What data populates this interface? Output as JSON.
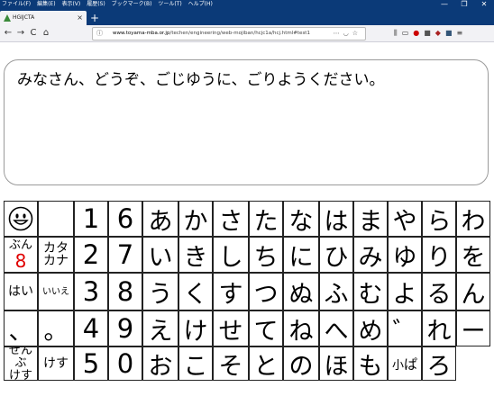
{
  "browser": {
    "menu_items": [
      "ファイル(F)",
      "編集(E)",
      "表示(V)",
      "履歴(S)",
      "ブックマーク(B)",
      "ツール(T)",
      "ヘルプ(H)"
    ],
    "window_controls": [
      "—",
      "❐",
      "✕"
    ],
    "tab_title": "HGIJCTA",
    "tab_close": "×",
    "new_tab": "+",
    "url_domain": "www.toyama-mba.or.jp",
    "url_path": "/techen/engineering/web-mojiban/hcjc1a/hcj.html#test1",
    "nav": {
      "back": "←",
      "forward": "→",
      "reload": "C",
      "home": "⌂"
    }
  },
  "message": {
    "text": "みなさん、どうぞ、ごじゆうに、ごりようください。"
  },
  "keyboard": {
    "rows": [
      [
        "smiley",
        "",
        "1",
        "6",
        "あ",
        "か",
        "さ",
        "た",
        "な",
        "は",
        "ま",
        "や",
        "ら",
        "わ"
      ],
      [
        "ぶん8",
        "カタカナ",
        "2",
        "7",
        "い",
        "き",
        "し",
        "ち",
        "に",
        "ひ",
        "み",
        "ゆ",
        "り",
        "を"
      ],
      [
        "はい",
        "いいえ",
        "3",
        "8",
        "う",
        "く",
        "す",
        "つ",
        "ぬ",
        "ふ",
        "む",
        "よ",
        "る",
        "ん"
      ],
      [
        "、",
        "。",
        "4",
        "9",
        "え",
        "け",
        "せ",
        "て",
        "ね",
        "へ",
        "め",
        "゛",
        "れ",
        "ー"
      ],
      [
        "ぜんぶけす",
        "けす",
        "5",
        "0",
        "お",
        "こ",
        "そ",
        "と",
        "の",
        "ほ",
        "も",
        "小",
        "ろ"
      ]
    ],
    "special": {
      "bun_label": "ぶん",
      "bun_value": "8",
      "katakana_line1": "カタ",
      "katakana_line2": "カナ",
      "zenbu_line1": "ぜんぶ",
      "zenbu_line2": "けす",
      "small_mark": "小",
      "small_char": "ぱ"
    }
  }
}
